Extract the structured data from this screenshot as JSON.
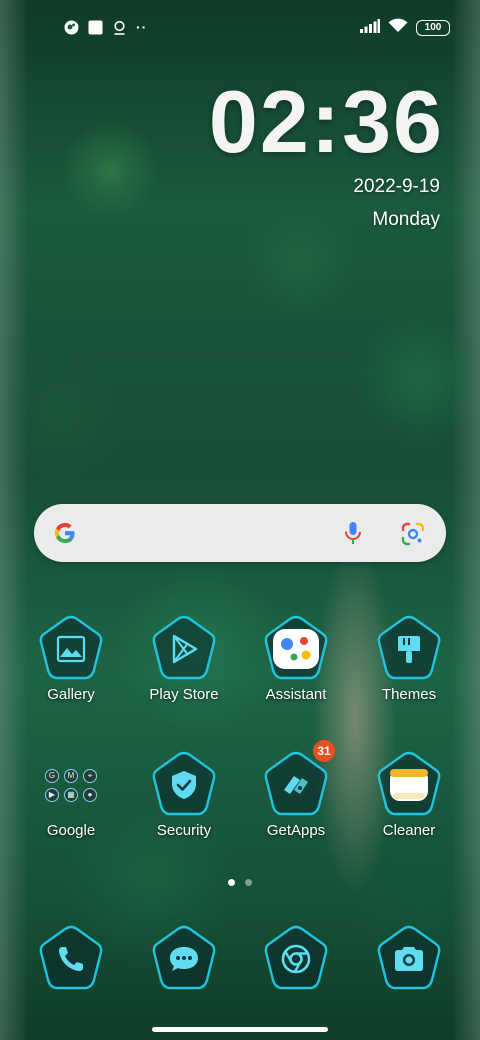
{
  "status_bar": {
    "left_icons": [
      "app-notification-icon",
      "square-notification-icon",
      "location-pin-icon",
      "more-dots-icon"
    ],
    "more_text": "··",
    "battery": "100"
  },
  "clock": {
    "time": "02:36",
    "date": "2022-9-19",
    "weekday": "Monday"
  },
  "search": {
    "brand": "G",
    "icons": [
      "google-logo-icon",
      "microphone-icon",
      "google-lens-icon"
    ]
  },
  "apps": [
    {
      "label": "Gallery",
      "icon": "gallery-icon"
    },
    {
      "label": "Play Store",
      "icon": "play-store-icon"
    },
    {
      "label": "Assistant",
      "icon": "assistant-icon"
    },
    {
      "label": "Themes",
      "icon": "paintbrush-icon"
    },
    {
      "label": "Google",
      "icon": "google-folder-icon",
      "folder_apps": [
        "G",
        "M",
        "⌖",
        "▶",
        "▦",
        "●"
      ]
    },
    {
      "label": "Security",
      "icon": "shield-check-icon"
    },
    {
      "label": "GetApps",
      "icon": "getapps-icon",
      "badge": "31"
    },
    {
      "label": "Cleaner",
      "icon": "cleaner-icon"
    }
  ],
  "page_indicator": {
    "pages": 2,
    "current": 1
  },
  "dock": [
    {
      "icon": "phone-icon"
    },
    {
      "icon": "messages-icon"
    },
    {
      "icon": "chrome-icon"
    },
    {
      "icon": "camera-icon"
    }
  ],
  "colors": {
    "accent": "#22c3dc",
    "badge": "#e8501f",
    "search_bg": "#e9eceb"
  }
}
